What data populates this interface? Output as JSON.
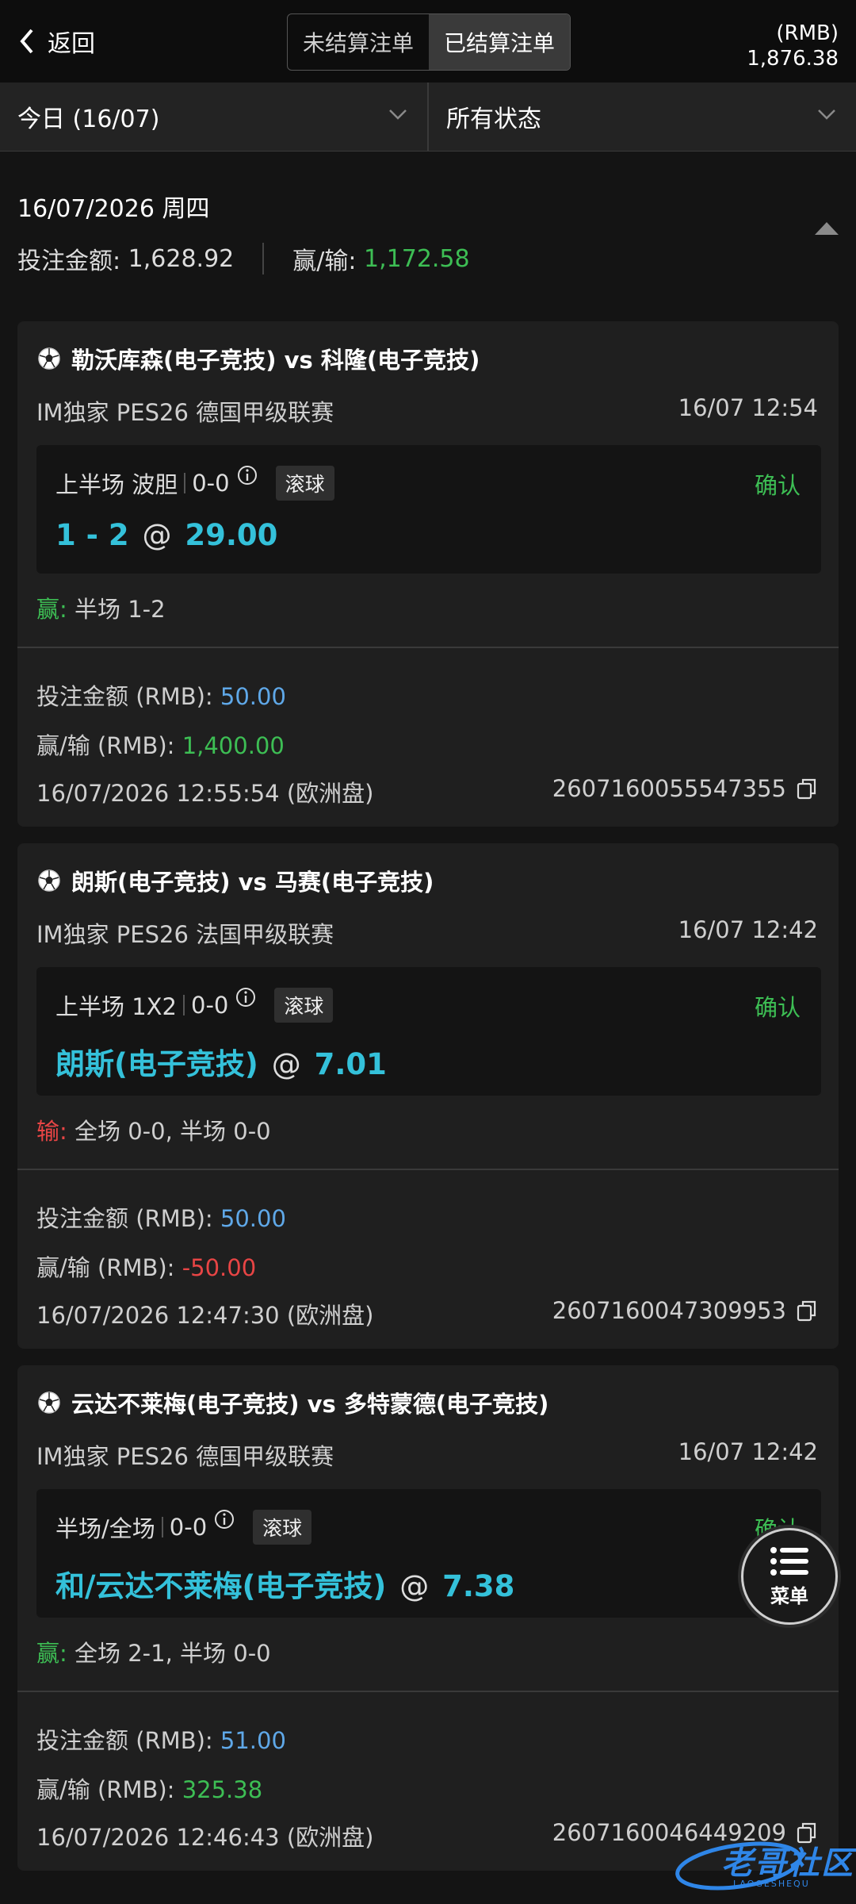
{
  "header": {
    "back_label": "返回",
    "tabs": [
      {
        "label": "未结算注单",
        "active": false
      },
      {
        "label": "已结算注单",
        "active": true
      }
    ],
    "currency": "(RMB)",
    "balance": "1,876.38"
  },
  "filters": {
    "date": "今日 (16/07)",
    "status": "所有状态"
  },
  "summary": {
    "date": "16/07/2026 周四",
    "stake_label": "投注金额:",
    "stake_value": "1,628.92",
    "winloss_label": "赢/输:",
    "winloss_value": "1,172.58"
  },
  "bets": [
    {
      "match": "勒沃库森(电子竞技) vs 科隆(电子竞技)",
      "league": "IM独家 PES26 德国甲级联赛",
      "kickoff": "16/07 12:54",
      "market": "上半场 波胆",
      "score": "0-0",
      "live_tag": "滚球",
      "status": "确认",
      "selection": "1 - 2",
      "at": "@",
      "odds": "29.00",
      "result_label": "赢:",
      "result_text": "半场 1-2",
      "stake_label": "投注金额 (RMB):",
      "stake": "50.00",
      "winloss_label": "赢/输 (RMB):",
      "winloss": "1,400.00",
      "placed": "16/07/2026 12:55:54 (欧洲盘)",
      "bet_id": "2607160055547355"
    },
    {
      "match": "朗斯(电子竞技) vs 马赛(电子竞技)",
      "league": "IM独家 PES26 法国甲级联赛",
      "kickoff": "16/07 12:42",
      "market": "上半场 1X2",
      "score": "0-0",
      "live_tag": "滚球",
      "status": "确认",
      "selection": "朗斯(电子竞技)",
      "at": "@",
      "odds": "7.01",
      "result_label": "输:",
      "result_text": "全场 0-0, 半场 0-0",
      "stake_label": "投注金额 (RMB):",
      "stake": "50.00",
      "winloss_label": "赢/输 (RMB):",
      "winloss": "-50.00",
      "placed": "16/07/2026 12:47:30 (欧洲盘)",
      "bet_id": "2607160047309953"
    },
    {
      "match": "云达不莱梅(电子竞技) vs 多特蒙德(电子竞技)",
      "league": "IM独家 PES26 德国甲级联赛",
      "kickoff": "16/07 12:42",
      "market": "半场/全场",
      "score": "0-0",
      "live_tag": "滚球",
      "status": "确认",
      "selection": "和/云达不莱梅(电子竞技)",
      "at": "@",
      "odds": "7.38",
      "result_label": "赢:",
      "result_text": "全场 2-1, 半场 0-0",
      "stake_label": "投注金额 (RMB):",
      "stake": "51.00",
      "winloss_label": "赢/输 (RMB):",
      "winloss": "325.38",
      "placed": "16/07/2026 12:46:43 (欧洲盘)",
      "bet_id": "2607160046449209"
    }
  ],
  "menu_label": "菜单",
  "watermark": {
    "text": "老哥社区",
    "sub": "LAOGESHEQU"
  },
  "colors": {
    "win": "#3dbe54",
    "loss": "#e84545",
    "stake": "#5fa8e8",
    "pick": "#34c1da"
  }
}
